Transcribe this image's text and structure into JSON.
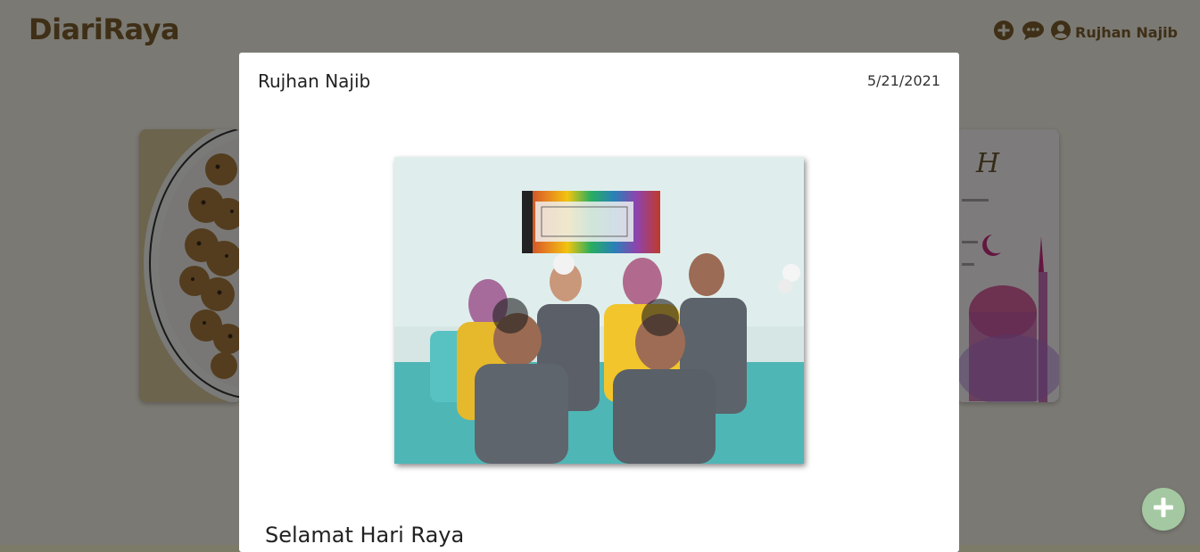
{
  "app": {
    "brand": "DiariRaya"
  },
  "nav": {
    "add_icon": "add-circle-icon",
    "chat_icon": "chat-bubble-icon",
    "user_icon": "account-circle-icon",
    "user_name": "Rujhan Najib"
  },
  "modal": {
    "author": "Rujhan Najib",
    "date": "5/21/2021",
    "title": "Selamat Hari Raya"
  },
  "fab": {
    "icon": "plus-icon"
  },
  "colors": {
    "brand": "#7c5f2d",
    "fab": "#a4c8a2",
    "overlay": "rgba(0,0,0,0.5)"
  }
}
